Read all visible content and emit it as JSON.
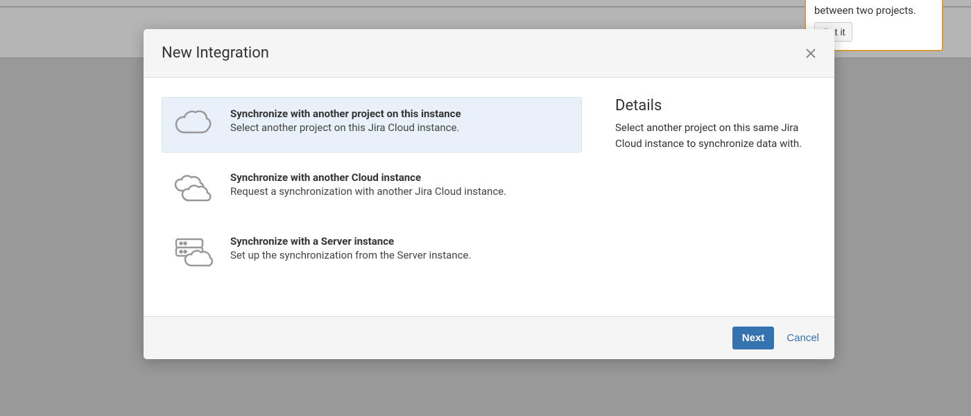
{
  "tooltip": {
    "text": "between two projects.",
    "button_label": "Got it"
  },
  "modal": {
    "title": "New Integration",
    "options": [
      {
        "title": "Synchronize with another project on this instance",
        "desc": "Select another project on this Jira Cloud instance."
      },
      {
        "title": "Synchronize with another Cloud instance",
        "desc": "Request a synchronization with another Jira Cloud instance."
      },
      {
        "title": "Synchronize with a Server instance",
        "desc": "Set up the synchronization from the Server instance."
      }
    ],
    "details": {
      "heading": "Details",
      "text": "Select another project on this same Jira Cloud instance to synchronize data with."
    },
    "footer": {
      "next_label": "Next",
      "cancel_label": "Cancel"
    }
  }
}
